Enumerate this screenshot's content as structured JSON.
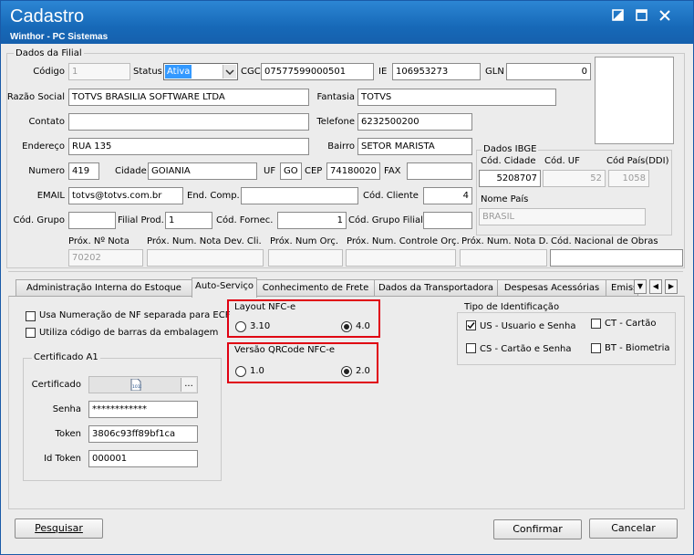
{
  "window": {
    "title": "Cadastro",
    "subtitle": "Winthor - PC Sistemas"
  },
  "dados_filial": {
    "group_title": "Dados da Filial",
    "codigo": {
      "label": "Código",
      "value": "1"
    },
    "status": {
      "label": "Status",
      "value": "Ativa"
    },
    "cgc": {
      "label": "CGC",
      "value": "07577599000501"
    },
    "ie": {
      "label": "IE",
      "value": "106953273"
    },
    "gln": {
      "label": "GLN",
      "value": "0"
    },
    "razao_social": {
      "label": "Razão Social",
      "value": "TOTVS BRASILIA SOFTWARE LTDA"
    },
    "fantasia": {
      "label": "Fantasia",
      "value": "TOTVS"
    },
    "contato": {
      "label": "Contato",
      "value": ""
    },
    "telefone": {
      "label": "Telefone",
      "value": "6232500200"
    },
    "endereco": {
      "label": "Endereço",
      "value": "RUA 135"
    },
    "bairro": {
      "label": "Bairro",
      "value": "SETOR MARISTA"
    },
    "numero": {
      "label": "Numero",
      "value": "419"
    },
    "cidade": {
      "label": "Cidade",
      "value": "GOIANIA"
    },
    "uf": {
      "label": "UF",
      "value": "GO"
    },
    "cep": {
      "label": "CEP",
      "value": "74180020"
    },
    "fax": {
      "label": "FAX",
      "value": ""
    },
    "email": {
      "label": "EMAIL",
      "value": "totvs@totvs.com.br"
    },
    "end_comp": {
      "label": "End. Comp.",
      "value": ""
    },
    "cod_cliente": {
      "label": "Cód. Cliente",
      "value": "4"
    },
    "cod_grupo": {
      "label": "Cód. Grupo",
      "value": ""
    },
    "filial_prod": {
      "label": "Filial Prod.",
      "value": "1"
    },
    "cod_fornec": {
      "label": "Cód. Fornec.",
      "value": "1"
    },
    "cod_grupo_filial": {
      "label": "Cód. Grupo Filial",
      "value": ""
    },
    "prox_nota": {
      "label": "Próx. Nº Nota",
      "value": "70202"
    },
    "prox_nota_dev": {
      "label": "Próx. Num. Nota Dev. Cli.",
      "value": ""
    },
    "prox_orc": {
      "label": "Próx. Num Orç.",
      "value": ""
    },
    "prox_controle_orc": {
      "label": "Próx. Num. Controle Orç.",
      "value": ""
    },
    "prox_nota_d": {
      "label": "Próx. Num. Nota D.",
      "value": ""
    },
    "cod_nac_obras": {
      "label": "Cód. Nacional de Obras",
      "value": ""
    }
  },
  "dados_ibge": {
    "group_title": "Dados IBGE",
    "cod_cidade": {
      "label": "Cód. Cidade",
      "value": "5208707"
    },
    "cod_uf": {
      "label": "Cód. UF",
      "value": "52"
    },
    "cod_pais": {
      "label": "Cód País(DDI)",
      "value": "1058"
    },
    "nome_pais": {
      "label": "Nome País",
      "value": "BRASIL"
    }
  },
  "tabs": [
    {
      "label": "Administração Interna do Estoque"
    },
    {
      "label": "Auto-Serviço"
    },
    {
      "label": "Conhecimento de Frete"
    },
    {
      "label": "Dados da Transportadora"
    },
    {
      "label": "Despesas Acessórias"
    },
    {
      "label": "Emiss"
    }
  ],
  "auto_servico": {
    "chk_numeracao": {
      "label": "Usa Numeração de NF separada para ECF",
      "checked": false
    },
    "chk_codbarras": {
      "label": "Utiliza código de barras da embalagem",
      "checked": false
    },
    "layout_nfce": {
      "title": "Layout NFC-e",
      "options": [
        "3.10",
        "4.0"
      ],
      "selected": "4.0"
    },
    "versao_qrcode": {
      "title": "Versão QRCode NFC-e",
      "options": [
        "1.0",
        "2.0"
      ],
      "selected": "2.0"
    },
    "tipo_identificacao": {
      "title": "Tipo de Identificação",
      "options": [
        {
          "label": "US - Usuario e Senha",
          "checked": true
        },
        {
          "label": "CT - Cartão",
          "checked": false
        },
        {
          "label": "CS - Cartão e Senha",
          "checked": false
        },
        {
          "label": "BT - Biometria",
          "checked": false
        }
      ]
    },
    "certificado": {
      "title": "Certificado A1",
      "certificado_label": "Certificado",
      "senha_label": "Senha",
      "senha_value": "************",
      "token_label": "Token",
      "token_value": "3806c93ff89bf1ca",
      "idtoken_label": "Id Token",
      "idtoken_value": "000001",
      "browse": "..."
    }
  },
  "buttons": {
    "pesquisar": "Pesquisar",
    "confirmar": "Confirmar",
    "cancelar": "Cancelar"
  },
  "colors": {
    "title_bar": "#1769b8",
    "highlight": "#e00012",
    "selected": "#3399ff"
  },
  "icons": [
    "restore-icon",
    "maximize-icon",
    "close-icon",
    "dropdown-arrow-icon",
    "file-icon",
    "scroll-left-icon",
    "scroll-right-icon",
    "checkmark-icon"
  ]
}
